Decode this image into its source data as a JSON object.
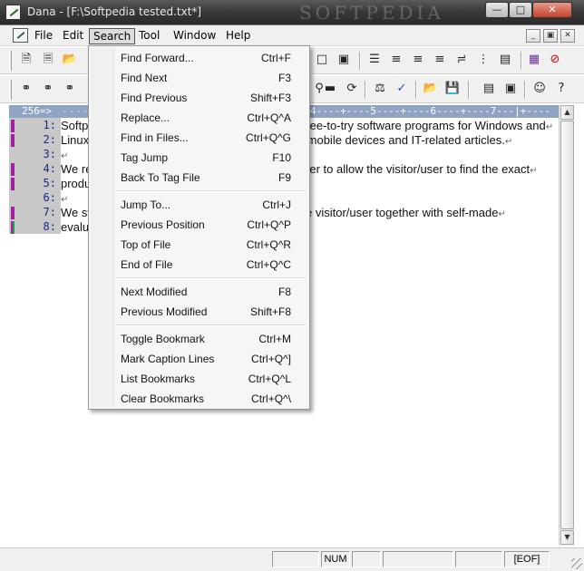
{
  "window": {
    "title": "Dana - [F:\\Softpedia tested.txt*]",
    "watermark": "SOFTPEDIA",
    "minimize_glyph": "—",
    "maximize_glyph": "□",
    "close_glyph": "✕"
  },
  "menubar": {
    "items": [
      "File",
      "Edit",
      "Search",
      "Tool",
      "Window",
      "Help"
    ],
    "active": "Search",
    "mdi_minimize": "_",
    "mdi_restore": "▣",
    "mdi_close": "✕"
  },
  "toolbar1": {
    "icons": [
      "new-file-icon",
      "new-document-icon",
      "open-folder-icon",
      "save-icon",
      "select-box-icon",
      "stamp-icon",
      "list-numbers-icon",
      "align-center-icon",
      "align-left-icon",
      "align-right-icon",
      "indent-icon",
      "grid-dots-icon",
      "columns-icon",
      "colored-grid-icon",
      "forbidden-icon"
    ]
  },
  "toolbar2": {
    "icons": [
      "binoculars-icon",
      "binoculars-next-icon",
      "binoculars-prev-icon",
      "replace-icon",
      "key-icon",
      "text-box-icon",
      "rotate-icon",
      "scales-icon",
      "spell-check-icon",
      "open-folder-icon",
      "save-disk-icon",
      "split-horizontal-icon",
      "split-window-icon",
      "smiley-icon",
      "help-pointer-icon"
    ]
  },
  "ruler": {
    "cursor_label": "256=>",
    "dashes": "------",
    "marks": "4----+----5----+----6----+----7---|+----"
  },
  "editor": {
    "lines": [
      {
        "number": "1:",
        "text": "Softpedia is a library of over 400,000 free and free-to-try software programs for Windows and",
        "marker": "modified"
      },
      {
        "number": "2:",
        "text": "Linux, games, Mac software, Windows drivers, mobile devices and IT-related articles.",
        "marker": "modified"
      },
      {
        "number": "3:",
        "text": "",
        "marker": "none"
      },
      {
        "number": "4:",
        "text": "We review and categorize these products in order to allow the visitor/user to find the exact",
        "marker": "modified"
      },
      {
        "number": "5:",
        "text": "product they and their system needs.",
        "marker": "modified"
      },
      {
        "number": "6:",
        "text": "",
        "marker": "none"
      },
      {
        "number": "7:",
        "text": "We strive to deliver only the best products to the visitor/user together with self-made",
        "marker": "modified"
      },
      {
        "number": "8:",
        "text": "evaluation and review notes.",
        "marker": "mixed"
      }
    ],
    "eol_glyph": "↵"
  },
  "dropdown": {
    "groups": [
      [
        {
          "label": "Find Forward...",
          "shortcut": "Ctrl+F"
        },
        {
          "label": "Find Next",
          "shortcut": "F3"
        },
        {
          "label": "Find Previous",
          "shortcut": "Shift+F3"
        },
        {
          "label": "Replace...",
          "shortcut": "Ctrl+Q^A"
        },
        {
          "label": "Find in Files...",
          "shortcut": "Ctrl+Q^G"
        },
        {
          "label": "Tag Jump",
          "shortcut": "F10"
        },
        {
          "label": "Back To Tag File",
          "shortcut": "F9"
        }
      ],
      [
        {
          "label": "Jump To...",
          "shortcut": "Ctrl+J"
        },
        {
          "label": "Previous Position",
          "shortcut": "Ctrl+Q^P"
        },
        {
          "label": "Top of File",
          "shortcut": "Ctrl+Q^R"
        },
        {
          "label": "End of File",
          "shortcut": "Ctrl+Q^C"
        }
      ],
      [
        {
          "label": "Next Modified",
          "shortcut": "F8"
        },
        {
          "label": "Previous Modified",
          "shortcut": "Shift+F8"
        }
      ],
      [
        {
          "label": "Toggle Bookmark",
          "shortcut": "Ctrl+M"
        },
        {
          "label": "Mark Caption Lines",
          "shortcut": "Ctrl+Q^]"
        },
        {
          "label": "List Bookmarks",
          "shortcut": "Ctrl+Q^L"
        },
        {
          "label": "Clear Bookmarks",
          "shortcut": "Ctrl+Q^\\"
        }
      ]
    ]
  },
  "statusbar": {
    "cells": [
      "",
      "NUM",
      "",
      "",
      "",
      "[EOF]"
    ]
  },
  "colors": {
    "marker_modified": "#a020a0",
    "marker_saved": "#20a040",
    "ruler_bg": "#8fa3c2",
    "gutter_bg": "#c8c8c8"
  }
}
